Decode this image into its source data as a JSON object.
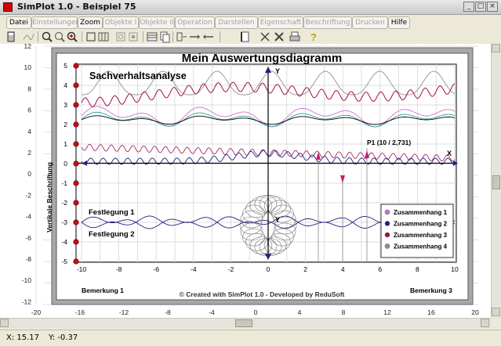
{
  "window": {
    "title": "SimPlot 1.0 - Beispiel 75"
  },
  "menu": [
    {
      "label": "Datei",
      "enabled": true
    },
    {
      "label": "Einstellungen",
      "enabled": false
    },
    {
      "label": "Zoom",
      "enabled": true
    },
    {
      "label": "Objekte I",
      "enabled": false
    },
    {
      "label": "Objekte II",
      "enabled": false
    },
    {
      "label": "Operation",
      "enabled": false
    },
    {
      "label": "Darstellen",
      "enabled": false
    },
    {
      "label": "Eigenschaft",
      "enabled": false
    },
    {
      "label": "Beschriftung",
      "enabled": false
    },
    {
      "label": "Drucken",
      "enabled": false
    },
    {
      "label": "Hilfe",
      "enabled": true
    }
  ],
  "toolbar_icons": [
    "calculator-icon",
    "curve-icon",
    "zoom-in-icon",
    "zoom-reset-icon",
    "zoom-out-icon",
    "frame-icon",
    "grid-icon",
    "graph-icon",
    "select-icon",
    "table-icon",
    "copy-icon",
    "stretch-icon",
    "arrow-right-icon",
    "arrow-left-icon",
    "page-icon",
    "cut-icon",
    "delete-icon",
    "print-icon",
    "help-icon"
  ],
  "plot": {
    "title": "Mein Auswertungsdiagramm",
    "subtitle": "Sachverhaltsanalyse",
    "ylabel": "Vertikale Beschriftung",
    "footer": "© Created with SimPlot 1.0 - Developed by ReduSoft",
    "bemerkung1": "Bemerkung 1",
    "bemerkung3": "Bemerkung 3",
    "festlegung1": "Festlegung 1",
    "festlegung2": "Festlegung 2",
    "point_label": "P1 (10 / 2,731)",
    "axis_x": "X",
    "axis_y": "Y",
    "inner_x_ticks": [
      "-10",
      "-8",
      "-6",
      "-4",
      "-2",
      "0",
      "2",
      "4",
      "6",
      "8",
      "10"
    ],
    "inner_y_ticks": [
      "5",
      "4",
      "3",
      "2",
      "1",
      "0",
      "-1",
      "-2",
      "-3",
      "-4",
      "-5"
    ],
    "outer_x_ticks": [
      "-20",
      "-16",
      "-12",
      "-8",
      "-4",
      "0",
      "4",
      "8",
      "12",
      "16",
      "20"
    ],
    "outer_y_ticks": [
      "12",
      "10",
      "8",
      "6",
      "4",
      "2",
      "0",
      "-2",
      "-4",
      "-6",
      "-8",
      "-10",
      "-12"
    ],
    "legend": [
      {
        "label": "Zusammenhang 1",
        "color": "#d070d0"
      },
      {
        "label": "Zusammenhang 2",
        "color": "#202080"
      },
      {
        "label": "Zusammenhang 3",
        "color": "#a01050"
      },
      {
        "label": "Zusammenhang 4",
        "color": "#909090"
      }
    ]
  },
  "status": {
    "x": "X: 15.17",
    "y": "Y: -0.37"
  }
}
